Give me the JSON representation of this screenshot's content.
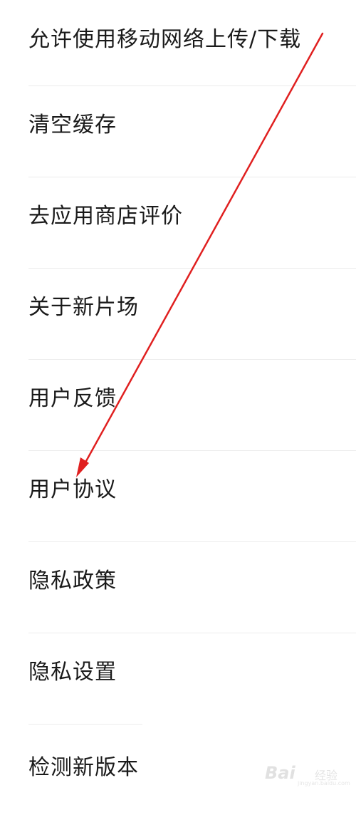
{
  "settings": {
    "items": [
      {
        "label": "允许使用移动网络上传/下载"
      },
      {
        "label": "清空缓存"
      },
      {
        "label": "去应用商店评价"
      },
      {
        "label": "关于新片场"
      },
      {
        "label": "用户反馈"
      },
      {
        "label": "用户协议"
      },
      {
        "label": "隐私政策"
      },
      {
        "label": "隐私设置"
      },
      {
        "label": "检测新版本"
      }
    ]
  },
  "annotation": {
    "arrow_color": "#e02020",
    "icon": "red-arrow-icon"
  },
  "watermark": {
    "brand": "Bai",
    "sub": "经验",
    "url": "jingyan.baidu.com"
  }
}
